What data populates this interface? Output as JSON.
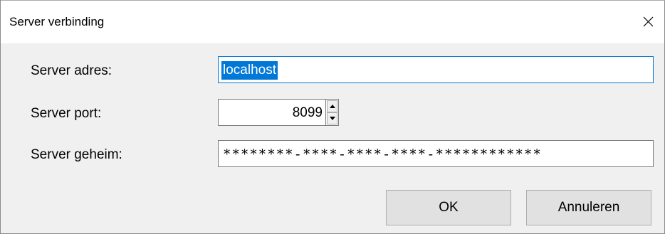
{
  "window": {
    "title": "Server verbinding",
    "close_icon": "close-icon"
  },
  "form": {
    "address": {
      "label": "Server adres:",
      "value": "localhost",
      "selected": true
    },
    "port": {
      "label": "Server port:",
      "value": "8099",
      "spinner_up_icon": "triangle-up-icon",
      "spinner_down_icon": "triangle-down-icon"
    },
    "secret": {
      "label": "Server geheim:",
      "value": "********-****-****-****-************"
    }
  },
  "buttons": {
    "ok_label": "OK",
    "cancel_label": "Annuleren"
  },
  "colors": {
    "selection": "#0078d7",
    "focus_border": "#0078d7",
    "dialog_background": "#f0f0f0",
    "button_face": "#e1e1e1"
  }
}
